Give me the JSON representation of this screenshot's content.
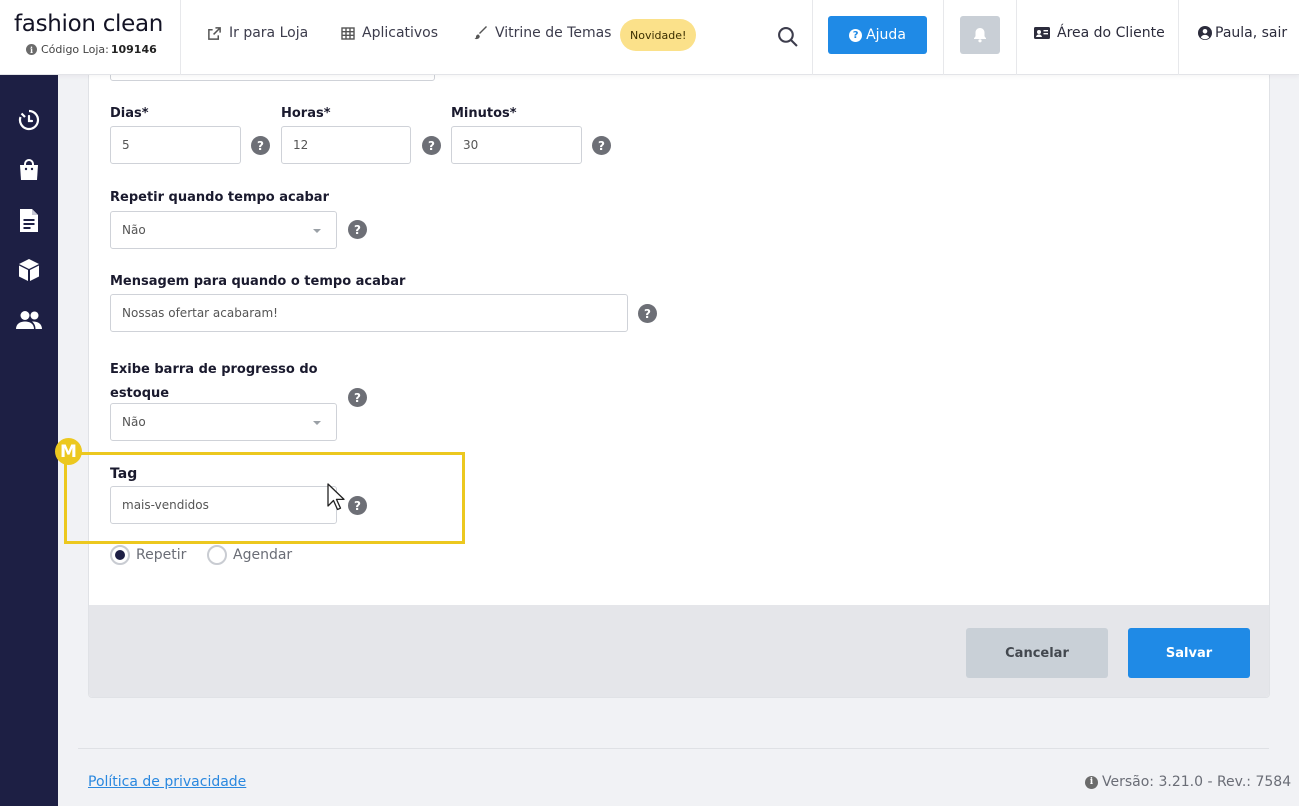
{
  "brand": {
    "name": "fashion clean",
    "code_label": "Código Loja:",
    "code_value": "109146"
  },
  "nav": {
    "store_link": "Ir para Loja",
    "apps_link": "Aplicativos",
    "themes_link": "Vitrine de Temas",
    "new_badge": "Novidade!",
    "help_label": "Ajuda",
    "client_area": "Área do Cliente",
    "user_label": "Paula, sair"
  },
  "sidebar": {
    "items": [
      {
        "icon": "timer-icon"
      },
      {
        "icon": "shopping-bag-icon"
      },
      {
        "icon": "document-icon"
      },
      {
        "icon": "box-icon"
      },
      {
        "icon": "users-icon"
      }
    ]
  },
  "form": {
    "days_label": "Dias*",
    "days_value": "5",
    "hours_label": "Horas*",
    "hours_value": "12",
    "minutes_label": "Minutos*",
    "minutes_value": "30",
    "repeat_label": "Repetir quando tempo acabar",
    "repeat_value": "Não",
    "message_label": "Mensagem para quando o tempo acabar",
    "message_value": "Nossas ofertar acabaram!",
    "progress_label_line1": "Exibe barra de progresso do",
    "progress_label_line2": "estoque",
    "progress_value": "Não",
    "tag_label": "Tag",
    "tag_value": "mais-vendidos",
    "radio_repeat": "Repetir",
    "radio_schedule": "Agendar",
    "help_glyph": "?"
  },
  "actions": {
    "cancel": "Cancelar",
    "save": "Salvar"
  },
  "annotation": {
    "marker": "M"
  },
  "footer": {
    "privacy": "Política de privacidade",
    "version": "Versão: 3.21.0 - Rev.: 7584"
  },
  "colors": {
    "accent": "#1f8ae6",
    "sidebar": "#1d1f44",
    "highlight": "#ecc81f",
    "badge": "#fbe18a"
  }
}
